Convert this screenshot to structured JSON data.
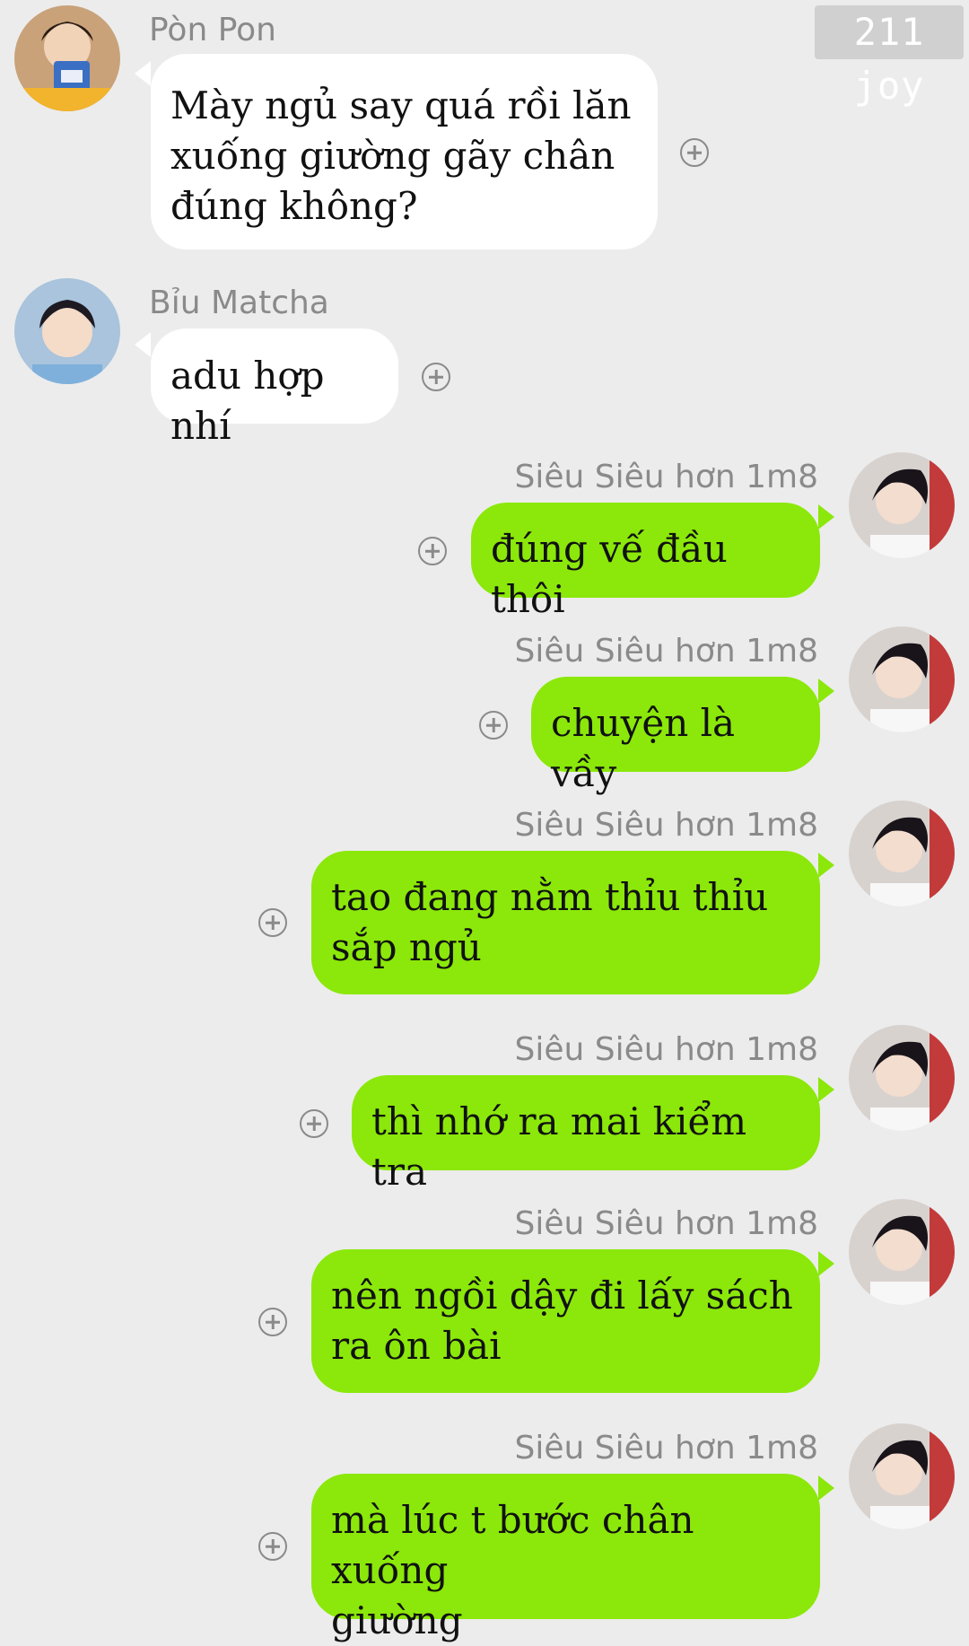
{
  "watermark": "211 joy",
  "messages": [
    {
      "sender": "Pòn Pon",
      "text": "Mày ngủ say quá rồi lăn\nxuống giường gãy chân\nđúng không?",
      "direction": "incoming",
      "avatar": "avatar-pon-pon"
    },
    {
      "sender": "Bỉu Matcha",
      "text": "adu hợp nhí",
      "direction": "incoming",
      "avatar": "avatar-biu-matcha"
    },
    {
      "sender": "Siêu Siêu hơn 1m8",
      "text": "đúng vế đầu thôi",
      "direction": "outgoing",
      "avatar": "avatar-sieu-sieu"
    },
    {
      "sender": "Siêu Siêu hơn 1m8",
      "text": "chuyện là vầy",
      "direction": "outgoing",
      "avatar": "avatar-sieu-sieu"
    },
    {
      "sender": "Siêu Siêu hơn 1m8",
      "text": "tao đang nằm thỉu thỉu\nsắp ngủ",
      "direction": "outgoing",
      "avatar": "avatar-sieu-sieu"
    },
    {
      "sender": "Siêu Siêu hơn 1m8",
      "text": "thì nhớ ra mai kiểm tra",
      "direction": "outgoing",
      "avatar": "avatar-sieu-sieu"
    },
    {
      "sender": "Siêu Siêu hơn 1m8",
      "text": "nên ngồi dậy đi lấy sách\nra ôn bài",
      "direction": "outgoing",
      "avatar": "avatar-sieu-sieu"
    },
    {
      "sender": "Siêu Siêu hơn 1m8",
      "text": "mà lúc t bước chân xuống\ngiường",
      "direction": "outgoing",
      "avatar": "avatar-sieu-sieu"
    }
  ],
  "colors": {
    "background": "#ececec",
    "incoming_bubble": "#ffffff",
    "outgoing_bubble": "#8be80a",
    "meta_text": "#8a8a8a"
  }
}
